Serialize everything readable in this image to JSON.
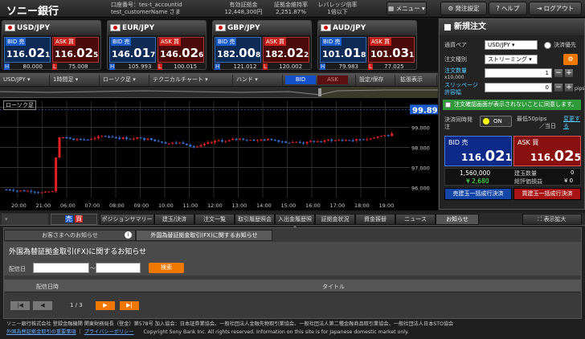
{
  "header": {
    "logo": "ソニー銀行",
    "account_label": "口座番号：",
    "account_id": "tes-t_accountid",
    "customer": "test_customerName さま",
    "margin_label": "有効証拠金",
    "margin_value": "12,448,300円",
    "ratio_label": "証拠金維持率",
    "ratio_value": "2,251.87%",
    "leverage_label": "レバレッジ倍率",
    "leverage_value": "1倍以下",
    "menu_btn": "メニュー",
    "order_settings_btn": "発注設定",
    "help_btn": "ヘルプ",
    "logout_btn": "ログアウト"
  },
  "pairs": [
    {
      "name": "USD/JPY",
      "bid_label": "BID 売",
      "ask_label": "ASK 買",
      "bid_a": "116.",
      "bid_b": "02",
      "bid_c": "1",
      "ask_a": "116.",
      "ask_b": "02",
      "ask_c": "5",
      "high": "80.000",
      "low": "75.008",
      "flag": "us-flag"
    },
    {
      "name": "EUR/JPY",
      "bid_label": "BID 売",
      "ask_label": "ASK 買",
      "bid_a": "146.",
      "bid_b": "01",
      "bid_c": "7",
      "ask_a": "146.",
      "ask_b": "02",
      "ask_c": "6",
      "high": "105.993",
      "low": "100.015",
      "flag": "eu-flag"
    },
    {
      "name": "GBP/JPY",
      "bid_label": "BID 売",
      "ask_label": "ASK 買",
      "bid_a": "182.",
      "bid_b": "00",
      "bid_c": "8",
      "ask_a": "182.",
      "ask_b": "02",
      "ask_c": "2",
      "high": "121.012",
      "low": "120.002",
      "flag": "uk-flag"
    },
    {
      "name": "AUD/JPY",
      "bid_label": "BID 売",
      "ask_label": "ASK 買",
      "bid_a": "101.",
      "bid_b": "01",
      "bid_c": "8",
      "ask_a": "101.",
      "ask_b": "03",
      "ask_c": "1",
      "high": "79.983",
      "low": "77.025",
      "flag": "au-flag"
    }
  ],
  "hl_labels": {
    "h": "H",
    "l": "L"
  },
  "toolbar": {
    "pair": "USD/JPY",
    "period": "1時間足",
    "chart_type": "ローソク足",
    "technical": "テクニカルチャート",
    "hand": "ハンド",
    "bid": "BID",
    "ask": "ASK",
    "save": "設定/保存",
    "expand": "拡張表示"
  },
  "chart": {
    "label": "ローソク足",
    "y_ticks": [
      "100.000",
      "99.000",
      "98.000",
      "97.000",
      "96.000"
    ],
    "x_ticks": [
      "20:00",
      "21:00",
      "06:00",
      "07:00",
      "08:00",
      "09:00",
      "10:00",
      "11:00",
      "12:00",
      "13:00",
      "14:00",
      "15:00",
      "16:00",
      "17:00",
      "18:00",
      "19:00"
    ],
    "last_price": "99.89",
    "last_price_small": "7"
  },
  "order": {
    "title": "新規注文",
    "pair_label": "通貨ペア",
    "pair_value": "USD/JPY",
    "priority_label": "決済優先",
    "type_label": "注文種別",
    "type_value": "ストリーミング",
    "qty_label": "注文数量",
    "qty_unit": "x10,000",
    "qty_value": "1",
    "slip_label": "スリッページ許容幅",
    "slip_value": "0",
    "slip_unit": "pips",
    "notice": "注文確認画面が表示されないことに同意します。",
    "simul_label": "決済同時発注",
    "simul_state": "ON",
    "max_label": "最低50pips",
    "max_unit": "／当日",
    "change_label": "変更する",
    "bid_label": "BID 売",
    "ask_label": "ASK 買",
    "bid_a": "116.",
    "bid_b": "02",
    "bid_c": "1",
    "ask_a": "116.",
    "ask_b": "02",
    "ask_c": "5",
    "position_qty": "1,560,000",
    "position_label": "建玉数量",
    "position_val": "0",
    "pl_value": "¥ 2,680",
    "pl_label": "総評価損益",
    "pl_val": "¥ 0",
    "sell_settle": "売建玉一括成行決済",
    "buy_settle": "買建玉一括成行決済"
  },
  "tabs": {
    "zoom": "表示拡大",
    "items": [
      "ポジションサマリー",
      "建玉/決済",
      "注文一覧",
      "取引履歴照会",
      "入出金履歴照会",
      "証拠金状況",
      "資金振替",
      "ニュース",
      "お知らせ"
    ],
    "sellbuy": "売 買"
  },
  "notice": {
    "tab1": "お客さまへのお知らせ",
    "tab2": "外国為替証拠金取引(FX)に関するお知らせ",
    "title": "外国為替証拠金取引(FX)に関するお知らせ",
    "date_label": "配信日",
    "tilde": "～",
    "search": "検索",
    "col_date": "配信日時",
    "col_title": "タイトル",
    "page": "1 / 3"
  },
  "footer": {
    "line1": "ソニー銀行株式会社 登録金融機関 関東財務局長（登金）第578号 加入協会：日本証券業協会、一般社団法人金融先物取引業協会、一般社団法人第二種金融商品取引業協会、一般社団法人日本STO協会",
    "line2a": "外国為替証拠金取引の重要事項",
    "line2b": "プライバシーポリシー",
    "line2c": "Copyright Sony Bank Inc. All rights reserved. Information on this site is for Japanese domestic market only."
  },
  "colors": {
    "bid": "#1450c8",
    "ask": "#c8201a",
    "green": "#2e9a3a",
    "orange": "#f07800"
  }
}
